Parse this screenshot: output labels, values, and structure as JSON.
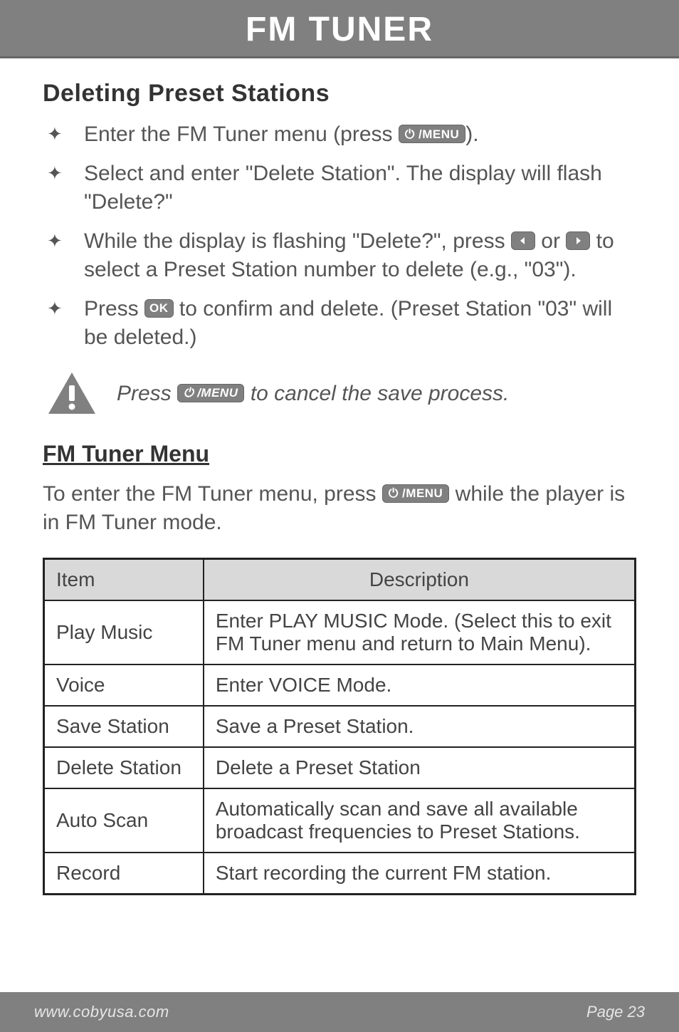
{
  "header": {
    "title": "FM TUNER"
  },
  "section1": {
    "heading": "Deleting Preset Stations",
    "bullets": [
      {
        "pre": "Enter the FM Tuner menu (press ",
        "key": "power-menu",
        "post": ")."
      },
      {
        "text": "Select and enter \"Delete Station\". The display will flash \"Delete?\""
      },
      {
        "pre": "While the display is flashing \"Delete?\", press ",
        "key1": "left",
        "mid": " or ",
        "key2": "right",
        "post": " to select a Preset Station number to delete (e.g., \"03\")."
      },
      {
        "pre": "Press ",
        "key": "ok",
        "post": " to confirm and delete. (Preset Station \"03\" will be deleted.)"
      }
    ]
  },
  "note": {
    "pre": "Press ",
    "key": "power-menu",
    "post": " to cancel the save process."
  },
  "section2": {
    "heading": "FM Tuner Menu",
    "intro_pre": "To enter the FM Tuner menu, press ",
    "intro_key": "power-menu",
    "intro_post": " while the player is in FM Tuner mode."
  },
  "table": {
    "head": {
      "item": "Item",
      "desc": "Description"
    },
    "rows": [
      {
        "item": "Play Music",
        "desc": "Enter PLAY MUSIC Mode. (Select this to exit FM Tuner menu and return to Main Menu)."
      },
      {
        "item": "Voice",
        "desc": "Enter VOICE Mode."
      },
      {
        "item": "Save Station",
        "desc": "Save a Preset Station."
      },
      {
        "item": "Delete Station",
        "desc": "Delete a Preset Station"
      },
      {
        "item": "Auto Scan",
        "desc": "Automatically scan and save all available broadcast frequencies to Preset Stations."
      },
      {
        "item": "Record",
        "desc": "Start recording the current FM station."
      }
    ]
  },
  "footer": {
    "url": "www.cobyusa.com",
    "page": "Page 23"
  },
  "keys": {
    "power-menu": "⏻ /MENU",
    "ok": "OK",
    "left": "<",
    "right": ">"
  }
}
